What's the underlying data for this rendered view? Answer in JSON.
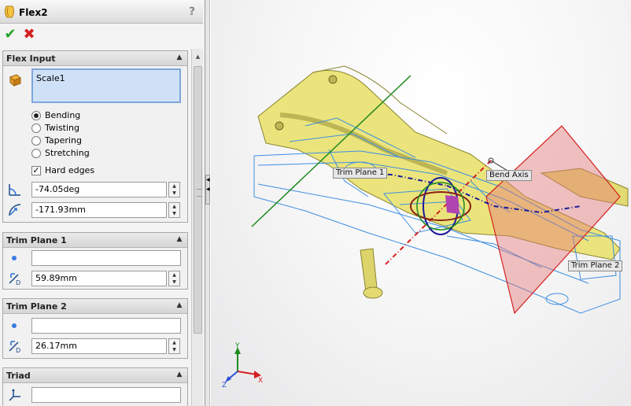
{
  "feature": {
    "title": "Flex2",
    "help": "?",
    "ok_glyph": "✔",
    "cancel_glyph": "✖"
  },
  "flex_input": {
    "header": "Flex Input",
    "selected_body": "Scale1",
    "options": [
      {
        "label": "Bending",
        "selected": true
      },
      {
        "label": "Twisting",
        "selected": false
      },
      {
        "label": "Tapering",
        "selected": false
      },
      {
        "label": "Stretching",
        "selected": false
      }
    ],
    "hard_edges_label": "Hard edges",
    "hard_edges_checked": true,
    "angle_value": "-74.05deg",
    "radius_value": "-171.93mm"
  },
  "trim_plane_1": {
    "header": "Trim Plane 1",
    "reference_value": "",
    "offset_value": "59.89mm"
  },
  "trim_plane_2": {
    "header": "Trim Plane 2",
    "reference_value": "",
    "offset_value": "26.17mm"
  },
  "triad": {
    "header": "Triad",
    "reference_value": ""
  },
  "viewport": {
    "labels": {
      "trim_plane_1": "Trim Plane 1",
      "bend_axis": "Bend Axis",
      "trim_plane_2": "Trim Plane 2"
    },
    "axes": {
      "x": "X",
      "y": "Y",
      "z": "Z"
    },
    "colors": {
      "part": "#e8e27a",
      "wireframe": "#3d8fe0",
      "trim_plane": "#d84040",
      "bend_axis": "#222222"
    }
  },
  "icons": {
    "feature_icon": "flex-feature-icon",
    "collapse": "▲",
    "spin_up": "▲",
    "spin_down": "▼"
  }
}
